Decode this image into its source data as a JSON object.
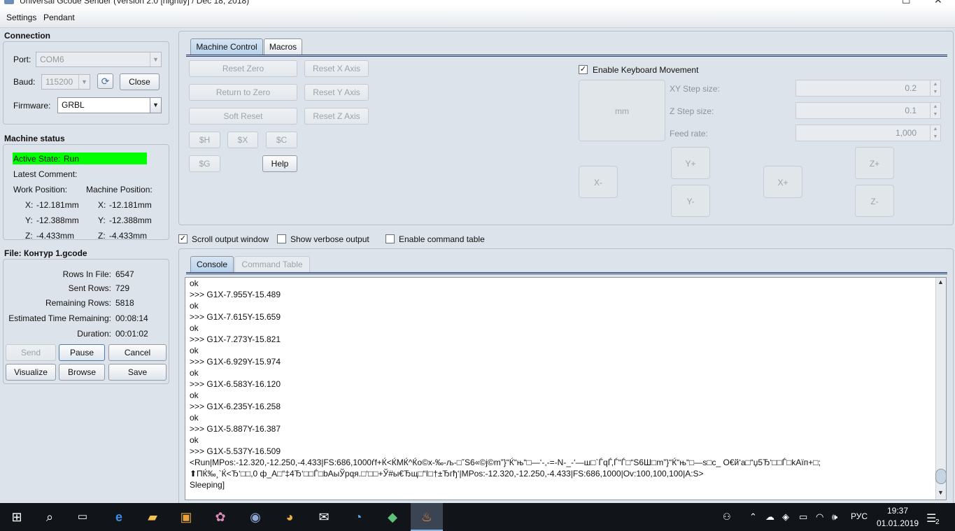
{
  "window": {
    "title": "Universal Gcode Sender (Version 2.0 [nightly] / Dec 18, 2018)"
  },
  "menu": [
    "Settings",
    "Pendant"
  ],
  "connection": {
    "title": "Connection",
    "port_label": "Port:",
    "port_value": "COM6",
    "baud_label": "Baud:",
    "baud_value": "115200",
    "close_label": "Close",
    "firmware_label": "Firmware:",
    "firmware_value": "GRBL"
  },
  "machine_status": {
    "title": "Machine status",
    "active_state_label": "Active State:",
    "active_state_value": "Run",
    "latest_comment_label": "Latest Comment:",
    "work_position_label": "Work Position:",
    "machine_position_label": "Machine Position:",
    "work": {
      "x_label": "X:",
      "x": "-12.181mm",
      "y_label": "Y:",
      "y": "-12.388mm",
      "z_label": "Z:",
      "z": "-4.433mm"
    },
    "machine": {
      "x_label": "X:",
      "x": "-12.181mm",
      "y_label": "Y:",
      "y": "-12.388mm",
      "z_label": "Z:",
      "z": "-4.433mm"
    }
  },
  "file": {
    "title": "File: Контур 1.gcode",
    "rows_in_file_label": "Rows In File:",
    "rows_in_file": "6547",
    "sent_rows_label": "Sent Rows:",
    "sent_rows": "729",
    "remaining_rows_label": "Remaining Rows:",
    "remaining_rows": "5818",
    "est_time_label": "Estimated Time Remaining:",
    "est_time": "00:08:14",
    "duration_label": "Duration:",
    "duration": "00:01:02",
    "buttons": {
      "send": "Send",
      "pause": "Pause",
      "cancel": "Cancel",
      "visualize": "Visualize",
      "browse": "Browse",
      "save": "Save"
    }
  },
  "control_tabs": [
    "Machine Control",
    "Macros"
  ],
  "machine_control": {
    "reset_zero": "Reset Zero",
    "return_to_zero": "Return to Zero",
    "soft_reset": "Soft Reset",
    "reset_x": "Reset X Axis",
    "reset_y": "Reset Y Axis",
    "reset_z": "Reset Z Axis",
    "cmd_h": "$H",
    "cmd_x": "$X",
    "cmd_c": "$C",
    "cmd_g": "$G",
    "help": "Help",
    "enable_keyboard": "Enable Keyboard Movement",
    "units": "mm",
    "xy_step_label": "XY Step size:",
    "xy_step": "0.2",
    "z_step_label": "Z Step size:",
    "z_step": "0.1",
    "feed_label": "Feed rate:",
    "feed": "1,000",
    "jog": {
      "x_minus": "X-",
      "x_plus": "X+",
      "y_plus": "Y+",
      "y_minus": "Y-",
      "z_plus": "Z+",
      "z_minus": "Z-"
    }
  },
  "options": {
    "scroll_output": "Scroll output window",
    "verbose": "Show verbose output",
    "command_table": "Enable command table"
  },
  "console_tabs": [
    "Console",
    "Command Table"
  ],
  "console_lines": [
    "ok",
    ">>> G1X-7.955Y-15.489",
    "ok",
    ">>> G1X-7.615Y-15.659",
    "ok",
    ">>> G1X-7.273Y-15.821",
    "ok",
    ">>> G1X-6.929Y-15.974",
    "ok",
    ">>> G1X-6.583Y-16.120",
    "ok",
    ">>> G1X-6.235Y-16.258",
    "ok",
    ">>> G1X-5.887Y-16.387",
    "ok",
    ">>> G1X-5.537Y-16.509",
    "<Run|MPos:-12.320,-12.250,-4.433|FS:686,1000ѓf+Ќ<ЌМЌ^Ќо©х-‰-љ-□ˇS6«©j©m”}“Ќ“њ“□—‘-,-=-N-_-‘—ш□`ЃqЃ,Ѓ“Ѓ□“S6Ш□m”}“Ќ“њ“□—s□c_ О€й‘а□“џ5Ђ‘□□Ѓ□kАїп+□;",
    "⬆ПЌ‰¸`Ќ<Ђ‘□□,0                   ф_А□“‡4Ђ‘□□Ѓ□bАыЎрqя.□‘□□+Ў#ы€Ђщ□“І□†±Ђгђ‘|MPos:-12.320,-12.250,-4.433|FS:686,1000|Ov:100,100,100|A:S>",
    "Sleeping]"
  ],
  "taskbar": {
    "lang": "РУС",
    "time": "19:37",
    "date": "01.01.2019",
    "notifications": "2"
  }
}
